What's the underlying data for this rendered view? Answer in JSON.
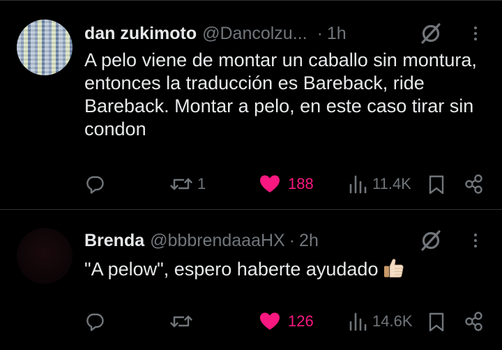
{
  "tweets": [
    {
      "name": "dan zukimoto",
      "handle": "@Dancolzu...",
      "separator": "·",
      "time": "1h",
      "text": "A pelo viene de montar un caballo sin montura, entonces la traducción es Bareback, ride Bareback. Montar a pelo, en este caso tirar sin condon",
      "reply_count": "",
      "retweet_count": "1",
      "like_count": "188",
      "view_count": "11.4K",
      "liked": true
    },
    {
      "name": "Brenda",
      "handle": "@bbbrendaaaHX",
      "separator": "·",
      "time": "2h",
      "text": "\"A pelow\", espero haberte ayudado",
      "emoji": "thumbs-up",
      "reply_count": "",
      "retweet_count": "",
      "like_count": "126",
      "view_count": "14.6K",
      "liked": true
    }
  ],
  "colors": {
    "background": "#000000",
    "text": "#e7e9ea",
    "secondary": "#71767b",
    "like": "#f91880",
    "divider": "#2f3336"
  }
}
